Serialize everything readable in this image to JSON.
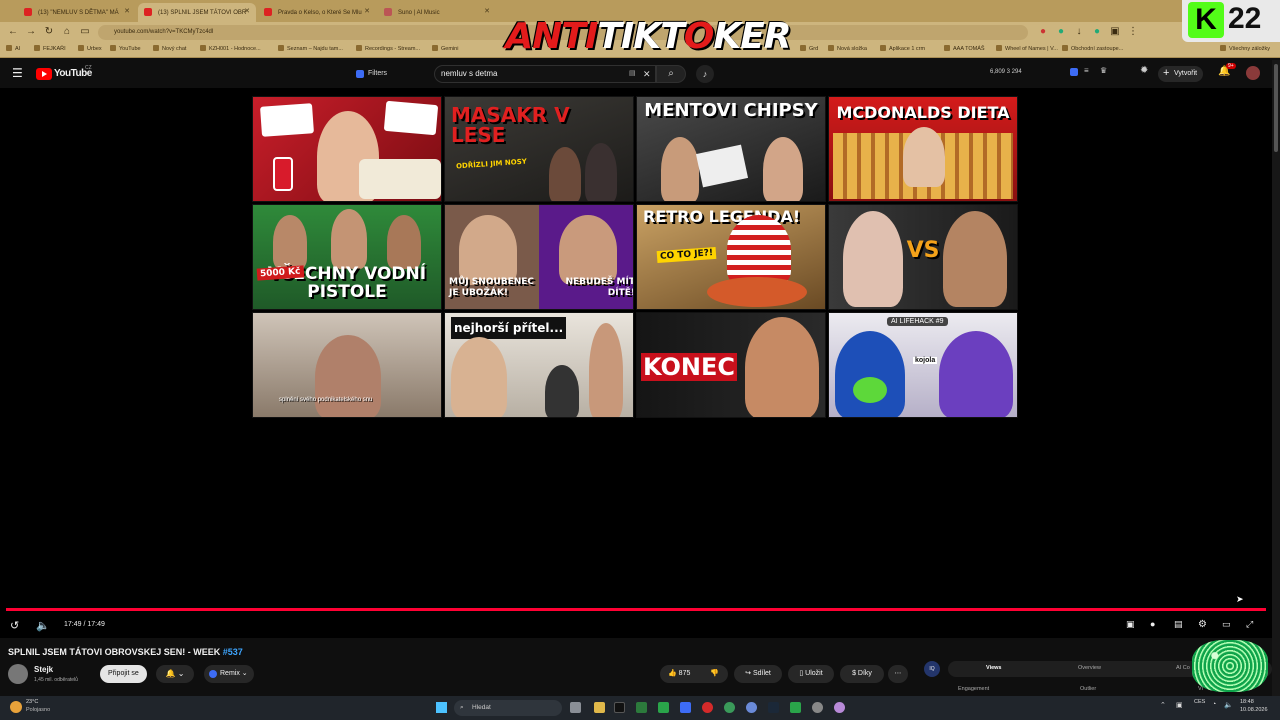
{
  "browser": {
    "tabs": [
      {
        "label": "(13) \"NEMLUV S DĚTMA\" MÁ"
      },
      {
        "label": "(13) SPLNIL JSEM TÁTOVI OBR"
      },
      {
        "label": "Pravda o Kelso, o Které Se Mlu"
      },
      {
        "label": "Suno | AI Music"
      }
    ],
    "address": "youtube.com/watch?v=TKCMyTzc4dl",
    "bookmarks": [
      "AI",
      "FEJKAŘI",
      "Urbex",
      "YouTube",
      "Nový chat",
      "KZH001 - Hodnoce...",
      "Seznam – Najdu tam...",
      "Recordings - Stream...",
      "Gemini",
      "Grd",
      "Nová složka",
      "Aplikace 1 crm",
      "AAA TOMÁŠ",
      "Wheel of Names | V...",
      "Obchodní zastoupe...",
      "Všechny záložky"
    ]
  },
  "overlay": {
    "logo_red": "ANTI",
    "logo_white": "TIKT",
    "logo_target": "O",
    "logo_white2": "KER",
    "kick_letter": "K",
    "kick_count": "22"
  },
  "youtube": {
    "brand": "YouTube",
    "country": "CZ",
    "filters_label": "Filters",
    "search_value": "nemluv s detma",
    "stats": "6,809   3   294",
    "create_label": "Vytvořit",
    "notif_count": "9+"
  },
  "thumbnails": [
    {
      "caption": "",
      "sub": ""
    },
    {
      "caption": "MASAKR V LESE",
      "sub": "ODŘÍZLI JIM NOSY"
    },
    {
      "caption": "MENTOVI CHIPSY",
      "sub": ""
    },
    {
      "caption": "MCDONALDS DIETA",
      "sub": ""
    },
    {
      "caption": "VŠECHNY VODNÍ PISTOLE",
      "sub": "5000 Kč"
    },
    {
      "caption": "MŮJ SNOUBENEC JE UBOŽÁK!",
      "sub": "NEBUDEŠ MÍT DÍTĚ!"
    },
    {
      "caption": "RETRO LEGENDA!",
      "sub": "CO TO JE?!"
    },
    {
      "caption": "VS",
      "sub": ""
    },
    {
      "caption": "",
      "sub": "splnění svého podnikatelského snu"
    },
    {
      "caption": "nejhorší přítel...",
      "sub": ""
    },
    {
      "caption": "KONEC",
      "sub": ""
    },
    {
      "caption": "AI LIFEHACK #9",
      "sub": "kojola"
    }
  ],
  "player": {
    "time": "17:49 / 17:49",
    "progress": 1.0
  },
  "video": {
    "title": "SPLNIL JSEM TÁTOVI OBROVSKEJ SEN! - WEEK",
    "tag": "#537",
    "channel": "Stejk",
    "subs": "1,45 mil. odběratelů",
    "join_label": "Připojit se",
    "remix_label": "Remix",
    "likes": "875",
    "share_label": "Sdílet",
    "save_label": "Uložit",
    "thanks_label": "Díky"
  },
  "panel": {
    "tabs": [
      "Views",
      "Overview",
      "AI Co"
    ],
    "labels": [
      "Engagement",
      "Outlier",
      "Vi"
    ]
  },
  "taskbar": {
    "temp": "23°C",
    "weather": "Polojasno",
    "search_label": "Hledat",
    "lang": "CES",
    "time": "18:48",
    "date": "10.08.2026"
  },
  "colors": {
    "accent": "#ff0033",
    "kick": "#53fc18",
    "youtube_red": "#ff0000"
  }
}
